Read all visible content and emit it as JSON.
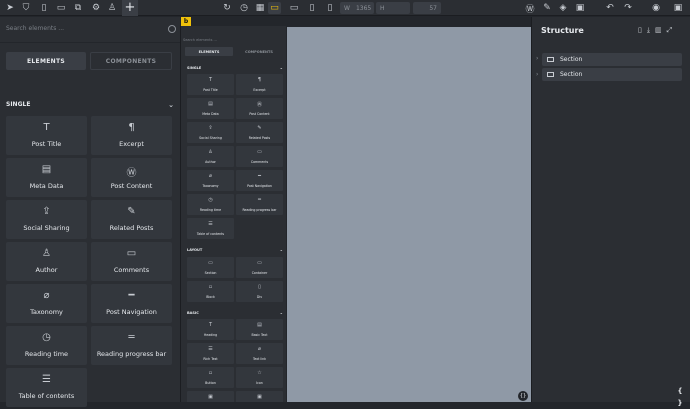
{
  "topbar": {
    "icons_left": [
      "cursor-icon",
      "logo-icon",
      "file-icon",
      "folder-icon",
      "file-copy-icon",
      "gear-icon",
      "user-icon"
    ],
    "add_glyph": "+",
    "center_icons": [
      "refresh-icon",
      "history-icon",
      "layout-icon",
      "desktop-icon",
      "laptop-icon",
      "tablet-icon",
      "phone-icon",
      "phone-small-icon"
    ],
    "width_label": "W",
    "width_value": "1365",
    "height_label": "H",
    "height_value": "",
    "zoom_value": "57",
    "icons_right": [
      "wordpress-icon",
      "paint-icon",
      "layers-icon",
      "template-icon",
      "undo-icon",
      "redo-icon",
      "eye-icon",
      "save-icon"
    ]
  },
  "left": {
    "search_placeholder": "Search elements ...",
    "tab_elements": "ELEMENTS",
    "tab_components": "COMPONENTS",
    "section_single": "SINGLE",
    "items": [
      {
        "label": "Post Title",
        "icon": "T"
      },
      {
        "label": "Excerpt",
        "icon": "¶"
      },
      {
        "label": "Meta Data",
        "icon": "▤"
      },
      {
        "label": "Post Content",
        "icon": "Ⓦ"
      },
      {
        "label": "Social Sharing",
        "icon": "⇪"
      },
      {
        "label": "Related Posts",
        "icon": "✎"
      },
      {
        "label": "Author",
        "icon": "♙"
      },
      {
        "label": "Comments",
        "icon": "▭"
      },
      {
        "label": "Taxonomy",
        "icon": "⌀"
      },
      {
        "label": "Post Navigation",
        "icon": "━"
      },
      {
        "label": "Reading time",
        "icon": "◷"
      },
      {
        "label": "Reading progress bar",
        "icon": "═"
      },
      {
        "label": "Table of contents",
        "icon": "☰"
      }
    ]
  },
  "mid": {
    "logo": "b",
    "search_placeholder": "Search elements ...",
    "tab_elements": "ELEMENTS",
    "tab_components": "COMPONENTS",
    "section_single": "SINGLE",
    "section_layout": "LAYOUT",
    "section_basic": "BASIC",
    "layout_items": [
      {
        "label": "Section",
        "icon": "▭"
      },
      {
        "label": "Container",
        "icon": "▭"
      },
      {
        "label": "Block",
        "icon": "▫"
      },
      {
        "label": "Div",
        "icon": "▯"
      }
    ],
    "basic_items": [
      {
        "label": "Heading",
        "icon": "T"
      },
      {
        "label": "Basic Text",
        "icon": "▤"
      },
      {
        "label": "Rich Text",
        "icon": "☰"
      },
      {
        "label": "Text link",
        "icon": "⌀"
      },
      {
        "label": "Button",
        "icon": "▫"
      },
      {
        "label": "Icon",
        "icon": "☆"
      },
      {
        "label": "Image",
        "icon": "▣"
      },
      {
        "label": "Video",
        "icon": "▣"
      }
    ]
  },
  "structure": {
    "title": "Structure",
    "rows": [
      {
        "label": "Section"
      },
      {
        "label": "Section"
      }
    ],
    "corner": "{ }"
  }
}
